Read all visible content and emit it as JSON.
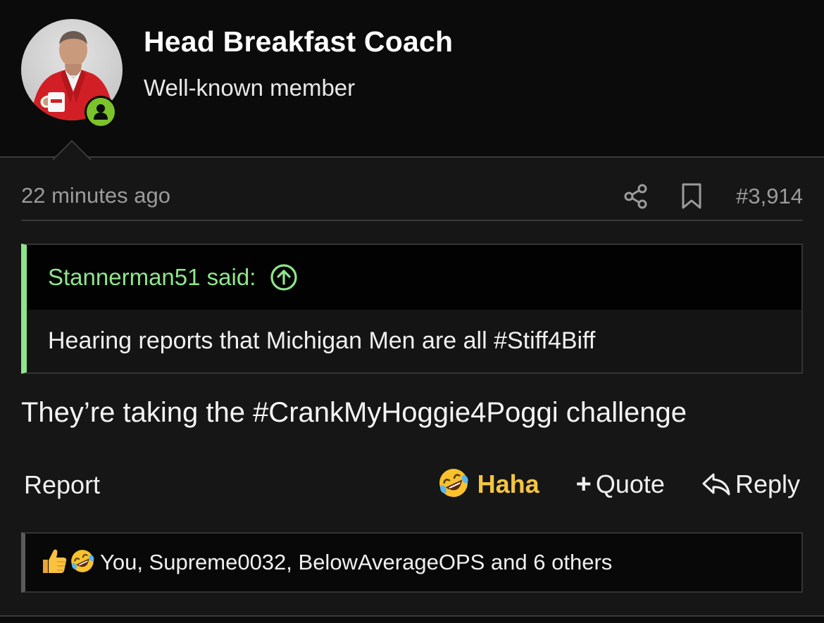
{
  "user": {
    "name": "Head Breakfast Coach",
    "title": "Well-known member",
    "online": true
  },
  "post": {
    "time": "22 minutes ago",
    "number": "#3,914",
    "message": "They’re taking the #CrankMyHoggie4Poggi challenge"
  },
  "quote": {
    "author": "Stannerman51 said:",
    "text": "Hearing reports that Michigan Men are all #Stiff4Biff"
  },
  "actions": {
    "report": "Report",
    "haha": "Haha",
    "quote": "Quote",
    "reply": "Reply"
  },
  "reactions": {
    "summary": "You, Supreme0032, BelowAverageOPS and 6 others",
    "icons": [
      "thumbs-up",
      "laughing-emoji"
    ]
  },
  "colors": {
    "quote_accent": "#8fe58c",
    "haha": "#f4c542",
    "online": "#7cc22b",
    "muted_text": "#9b9b9b"
  }
}
